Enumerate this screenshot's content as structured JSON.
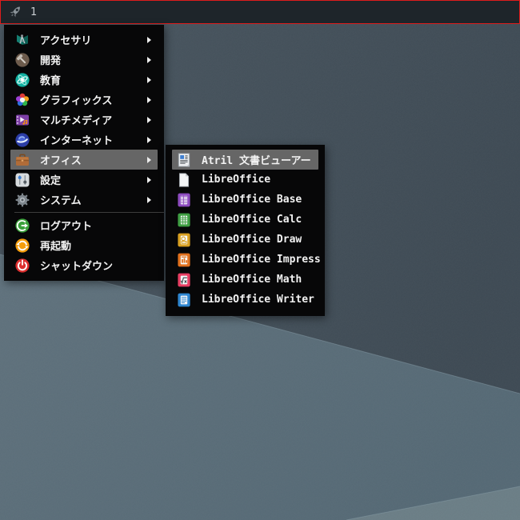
{
  "theme": {
    "accent_red": "#dd1c1c",
    "panel_bg": "#1e252a",
    "menu_bg": "#070708",
    "menu_highlight": "#666666",
    "menu_text": "#f2f2f2",
    "wallpaper_dark_left": "#48555f",
    "wallpaper_dark_right": "#3c4852",
    "wallpaper_light_left": "#5e707b",
    "wallpaper_light_right": "#536773",
    "wallpaper_corner": "#697c84"
  },
  "panel": {
    "workspace_label": "1",
    "launcher_icon": "rocket-icon"
  },
  "menu": {
    "items": [
      {
        "id": "accessories",
        "label": "アクセサリ",
        "icon": "accessories",
        "has_submenu": true,
        "selected": false
      },
      {
        "id": "development",
        "label": "開発",
        "icon": "development",
        "has_submenu": true,
        "selected": false
      },
      {
        "id": "education",
        "label": "教育",
        "icon": "education",
        "has_submenu": true,
        "selected": false
      },
      {
        "id": "graphics",
        "label": "グラフィックス",
        "icon": "graphics",
        "has_submenu": true,
        "selected": false
      },
      {
        "id": "multimedia",
        "label": "マルチメディア",
        "icon": "multimedia",
        "has_submenu": true,
        "selected": false
      },
      {
        "id": "internet",
        "label": "インターネット",
        "icon": "internet",
        "has_submenu": true,
        "selected": false
      },
      {
        "id": "office",
        "label": "オフィス",
        "icon": "office",
        "has_submenu": true,
        "selected": true
      },
      {
        "id": "settings",
        "label": "設定",
        "icon": "settings",
        "has_submenu": true,
        "selected": false
      },
      {
        "id": "system",
        "label": "システム",
        "icon": "system",
        "has_submenu": true,
        "selected": false
      }
    ],
    "session_items": [
      {
        "id": "logout",
        "label": "ログアウト",
        "icon": "logout",
        "has_submenu": false,
        "selected": false
      },
      {
        "id": "restart",
        "label": "再起動",
        "icon": "restart",
        "has_submenu": false,
        "selected": false
      },
      {
        "id": "shutdown",
        "label": "シャットダウン",
        "icon": "shutdown",
        "has_submenu": false,
        "selected": false
      }
    ]
  },
  "submenu": {
    "items": [
      {
        "id": "atril",
        "label": "Atril 文書ビューアー",
        "icon": "atril",
        "selected": true
      },
      {
        "id": "libreoffice",
        "label": "LibreOffice",
        "icon": "libreoffice",
        "selected": false
      },
      {
        "id": "libreoffice-base",
        "label": "LibreOffice Base",
        "icon": "base",
        "selected": false
      },
      {
        "id": "libreoffice-calc",
        "label": "LibreOffice Calc",
        "icon": "calc",
        "selected": false
      },
      {
        "id": "libreoffice-draw",
        "label": "LibreOffice Draw",
        "icon": "draw",
        "selected": false
      },
      {
        "id": "libreoffice-impress",
        "label": "LibreOffice Impress",
        "icon": "impress",
        "selected": false
      },
      {
        "id": "libreoffice-math",
        "label": "LibreOffice Math",
        "icon": "math",
        "selected": false
      },
      {
        "id": "libreoffice-writer",
        "label": "LibreOffice Writer",
        "icon": "writer",
        "selected": false
      }
    ]
  }
}
